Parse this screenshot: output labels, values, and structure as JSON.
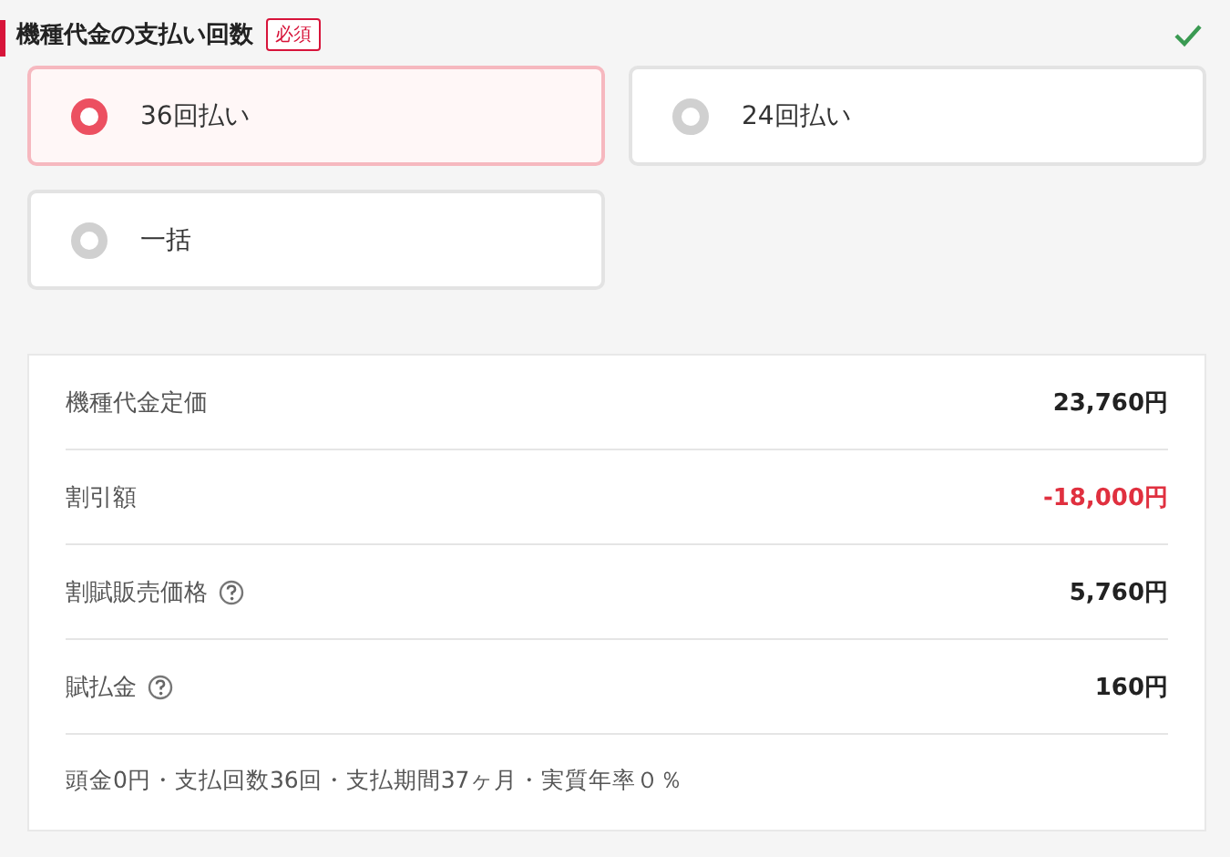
{
  "section": {
    "title": "機種代金の支払い回数",
    "badge": "必須",
    "complete": true
  },
  "options": [
    {
      "label": "36回払い",
      "selected": true
    },
    {
      "label": "24回払い",
      "selected": false
    },
    {
      "label": "一括",
      "selected": false
    }
  ],
  "summary": {
    "rows": [
      {
        "label": "機種代金定価",
        "value": "23,760円",
        "kind": "normal",
        "help": false
      },
      {
        "label": "割引額",
        "value": "-18,000円",
        "kind": "discount",
        "help": false
      },
      {
        "label": "割賦販売価格",
        "value": "5,760円",
        "kind": "normal",
        "help": true
      },
      {
        "label": "賦払金",
        "value": "160円",
        "kind": "normal",
        "help": true
      }
    ],
    "note": "頭金0円・支払回数36回・支払期間37ヶ月・実質年率０％"
  }
}
